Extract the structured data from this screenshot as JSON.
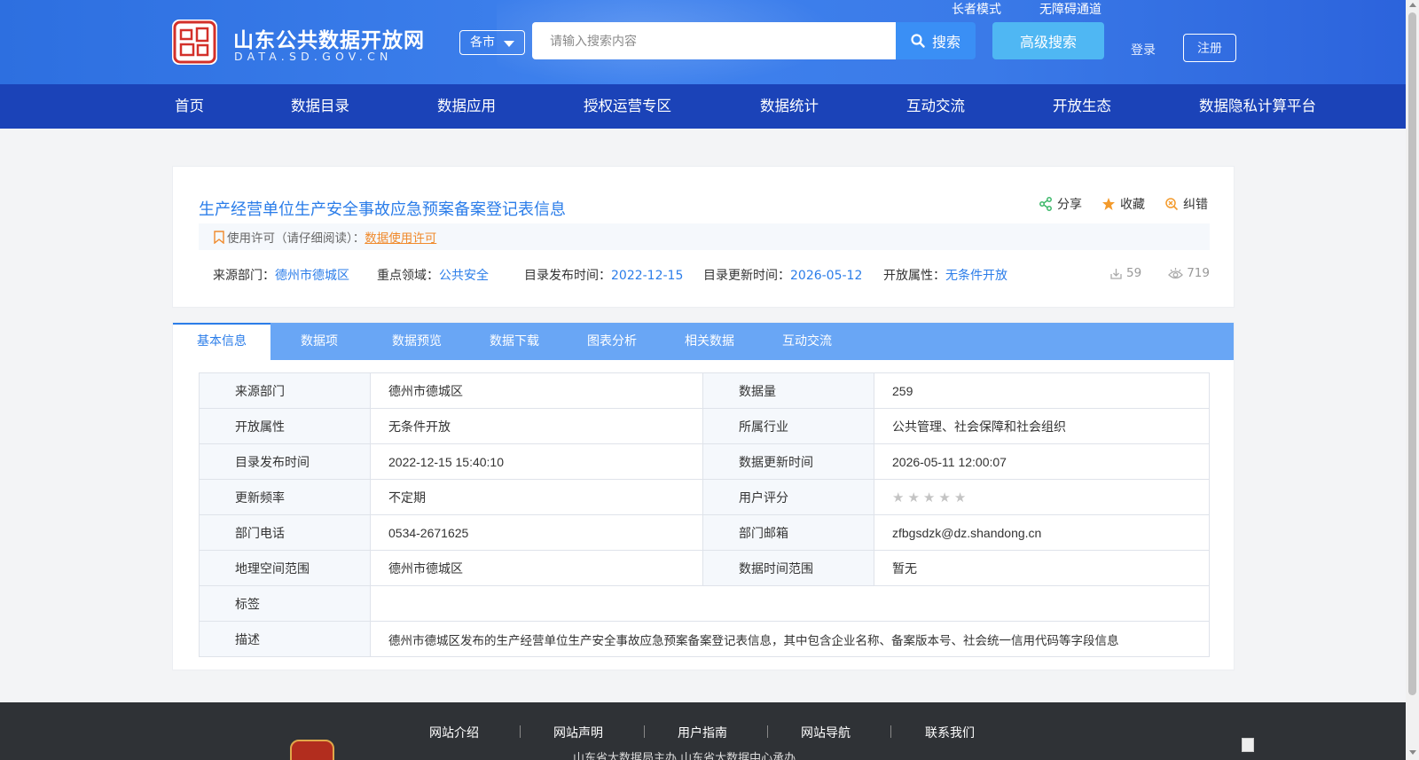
{
  "header": {
    "site_title": "山东公共数据开放网",
    "site_subtitle": "DATA.SD.GOV.CN",
    "city_select": "各市",
    "search_placeholder": "请输入搜索内容",
    "search_button": "搜索",
    "advanced_search": "高级搜索",
    "elder_mode": "长者模式",
    "accessibility": "无障碍通道",
    "login": "登录",
    "register": "注册"
  },
  "nav": {
    "items": [
      "首页",
      "数据目录",
      "数据应用",
      "授权运营专区",
      "数据统计",
      "互动交流",
      "开放生态",
      "数据隐私计算平台"
    ]
  },
  "dataset": {
    "title": "生产经营单位生产安全事故应急预案备案登记表信息",
    "actions": {
      "share": "分享",
      "favorite": "收藏",
      "correct": "纠错"
    },
    "license_prefix": "使用许可（请仔细阅读）：",
    "license_link": "数据使用许可",
    "meta": {
      "source_label": "来源部门：",
      "source_value": "德州市德城区",
      "domain_label": "重点领域：",
      "domain_value": "公共安全",
      "publish_label": "目录发布时间：",
      "publish_value": "2022-12-15",
      "update_label": "目录更新时间：",
      "update_value": "2026-05-12",
      "open_label": "开放属性：",
      "open_value": "无条件开放"
    },
    "downloads": "59",
    "views": "719"
  },
  "tabs": {
    "items": [
      "基本信息",
      "数据项",
      "数据预览",
      "数据下载",
      "图表分析",
      "相关数据",
      "互动交流"
    ],
    "active": "基本信息"
  },
  "info": {
    "source_dept_label": "来源部门",
    "source_dept": "德州市德城区",
    "data_volume_label": "数据量",
    "data_volume": "259",
    "open_attr_label": "开放属性",
    "open_attr": "无条件开放",
    "industry_label": "所属行业",
    "industry": "公共管理、社会保障和社会组织",
    "publish_time_label": "目录发布时间",
    "publish_time": "2022-12-15 15:40:10",
    "update_time_label": "数据更新时间",
    "update_time": "2026-05-11 12:00:07",
    "frequency_label": "更新频率",
    "frequency": "不定期",
    "rating_label": "用户评分",
    "rating": 0,
    "rating_max": 5,
    "phone_label": "部门电话",
    "phone": "0534-2671625",
    "email_label": "部门邮箱",
    "email": "zfbgsdzk@dz.shandong.cn",
    "geo_label": "地理空间范围",
    "geo": "德州市德城区",
    "time_range_label": "数据时间范围",
    "time_range": "暂无",
    "tags_label": "标签",
    "tags": "",
    "desc_label": "描述",
    "desc": "德州市德城区发布的生产经营单位生产安全事故应急预案备案登记表信息，其中包含企业名称、备案版本号、社会统一信用代码等字段信息"
  },
  "footer": {
    "links": [
      "网站介绍",
      "网站声明",
      "用户指南",
      "网站导航",
      "联系我们"
    ],
    "text": "山东省大数据局主办   山东省大数据中心承办"
  },
  "colors": {
    "header_blue": "#3a7ae8",
    "nav_blue": "#1b43b8",
    "link_blue": "#2b7de9",
    "tab_bar": "#69a6f5",
    "license_orange": "#f08a2c",
    "footer_dark": "#2f3236"
  }
}
